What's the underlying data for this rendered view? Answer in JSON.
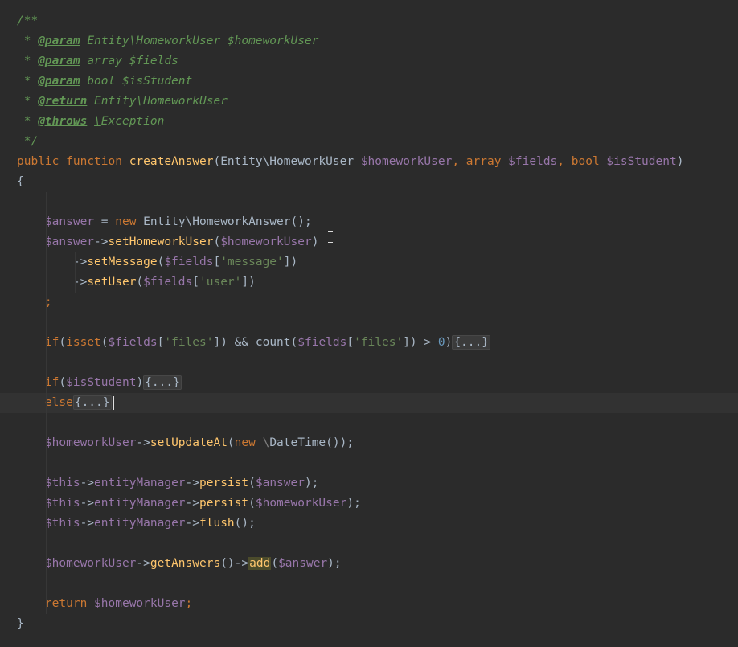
{
  "doc": {
    "open": "/**",
    "star": " * ",
    "close": " */",
    "param_tag": "@param",
    "return_tag": "@return",
    "throws_tag": "@throws",
    "param1_text": " Entity\\HomeworkUser $homeworkUser",
    "param2_text": " array $fields",
    "param3_text": " bool $isStudent",
    "return_text": " Entity\\HomeworkUser",
    "throws_slash": "\\",
    "throws_text": "Exception"
  },
  "sig": {
    "public": "public",
    "function": "function",
    "name": "createAnswer",
    "open_paren": "(",
    "type1": "Entity\\HomeworkUser",
    "var1": "$homeworkUser",
    "comma1": ", ",
    "type2": "array",
    "var2": "$fields",
    "comma2": ", ",
    "type3": "bool",
    "var3": "$isStudent",
    "close_paren": ")"
  },
  "brace_open": "{",
  "brace_close": "}",
  "code": {
    "l1_var": "$answer",
    "l1_eq": " = ",
    "l1_new": "new",
    "l1_class": " Entity\\HomeworkAnswer();",
    "l2_var": "$answer",
    "l2_arrow": "->",
    "l2_fn": "setHomeworkUser",
    "l2_open": "(",
    "l2_arg": "$homeworkUser",
    "l2_close": ")",
    "l3_arrow": "->",
    "l3_fn": "setMessage",
    "l3_open": "(",
    "l3_var": "$fields",
    "l3_lb": "[",
    "l3_str": "'message'",
    "l3_rb": "])",
    "l4_arrow": "->",
    "l4_fn": "setUser",
    "l4_open": "(",
    "l4_var": "$fields",
    "l4_lb": "[",
    "l4_str": "'user'",
    "l4_rb": "])",
    "l5_semi": ";",
    "if1_kw": "if",
    "if1_open": "(",
    "if1_isset": "isset",
    "if1_p": "(",
    "if1_var": "$fields",
    "if1_lb": "[",
    "if1_str": "'files'",
    "if1_rb": "]) && ",
    "if1_count": "count",
    "if1_p2": "(",
    "if1_var2": "$fields",
    "if1_lb2": "[",
    "if1_str2": "'files'",
    "if1_rb2": "]) > ",
    "if1_num": "0",
    "if1_close": ")",
    "fold": "{...}",
    "if2_kw": "if",
    "if2_open": "(",
    "if2_var": "$isStudent",
    "if2_close": ")",
    "else_kw": "else",
    "upd_var": "$homeworkUser",
    "upd_arrow": "->",
    "upd_fn": "setUpdateAt",
    "upd_open": "(",
    "upd_new": "new",
    "upd_ns": " \\",
    "upd_class": "DateTime",
    "upd_close": "());",
    "this": "$this",
    "arrow": "->",
    "em": "entityManager",
    "persist": "persist",
    "flush": "flush",
    "p1_arg": "$answer",
    "p2_arg": "$homeworkUser",
    "p_open": "(",
    "p_close": ");",
    "flush_call": "();",
    "ga_var": "$homeworkUser",
    "ga_arrow": "->",
    "ga_fn": "getAnswers",
    "ga_call": "()->",
    "ga_add": "add",
    "ga_open": "(",
    "ga_arg": "$answer",
    "ga_close": ");",
    "ret_kw": "return",
    "ret_var": " $homeworkUser",
    "ret_semi": ";"
  }
}
